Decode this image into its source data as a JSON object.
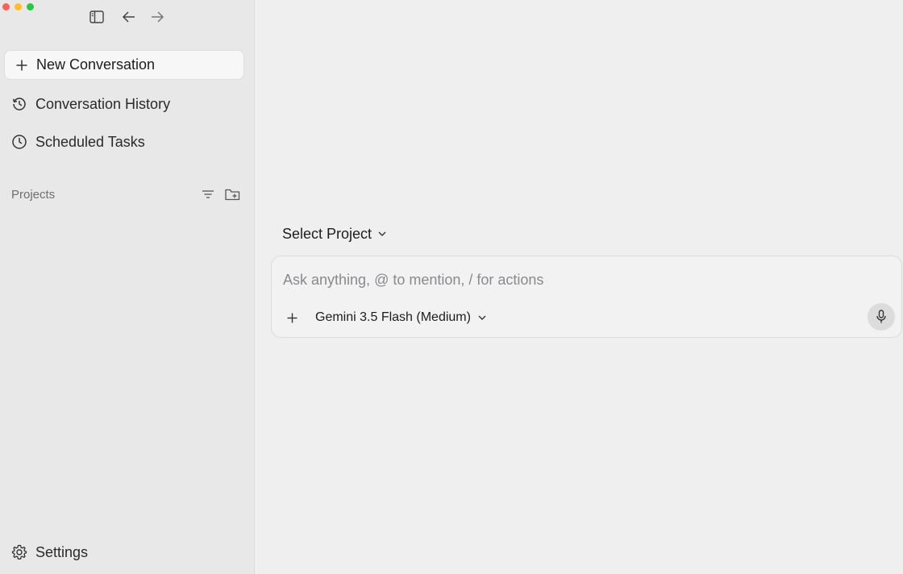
{
  "window": {
    "traffic_colors": [
      "#fe5f57",
      "#febc2e",
      "#28c840"
    ]
  },
  "toolbar": {
    "icons": [
      "sidebar-toggle-icon",
      "arrow-left-icon",
      "arrow-right-icon"
    ]
  },
  "sidebar": {
    "new_conversation": "New Conversation",
    "items": [
      {
        "label": "Conversation History",
        "icon": "history-icon"
      },
      {
        "label": "Scheduled Tasks",
        "icon": "clock-icon"
      }
    ],
    "projects_label": "Projects",
    "settings_label": "Settings"
  },
  "main": {
    "select_project": "Select Project",
    "composer": {
      "placeholder": "Ask anything, @ to mention, / for actions",
      "value": "",
      "model": "Gemini 3.5 Flash (Medium)"
    }
  }
}
